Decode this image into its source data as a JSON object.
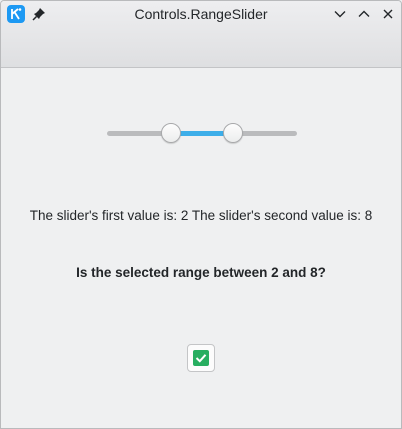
{
  "window": {
    "title": "Controls.RangeSlider"
  },
  "slider": {
    "min": 0,
    "max": 10,
    "first_value": 2,
    "second_value": 8,
    "accent_color": "#3daee9"
  },
  "labels": {
    "first_value_text": "The slider's first value is: 2",
    "second_value_text": "The slider's second value is: 8",
    "question": "Is the selected range between 2 and 8?"
  },
  "checkbox": {
    "checked": true,
    "color": "#27ae60"
  },
  "icons": {
    "app": "kde-app-icon",
    "pin": "pin-icon",
    "minimize": "chevron-down-icon",
    "maximize": "chevron-up-icon",
    "close": "close-icon"
  }
}
